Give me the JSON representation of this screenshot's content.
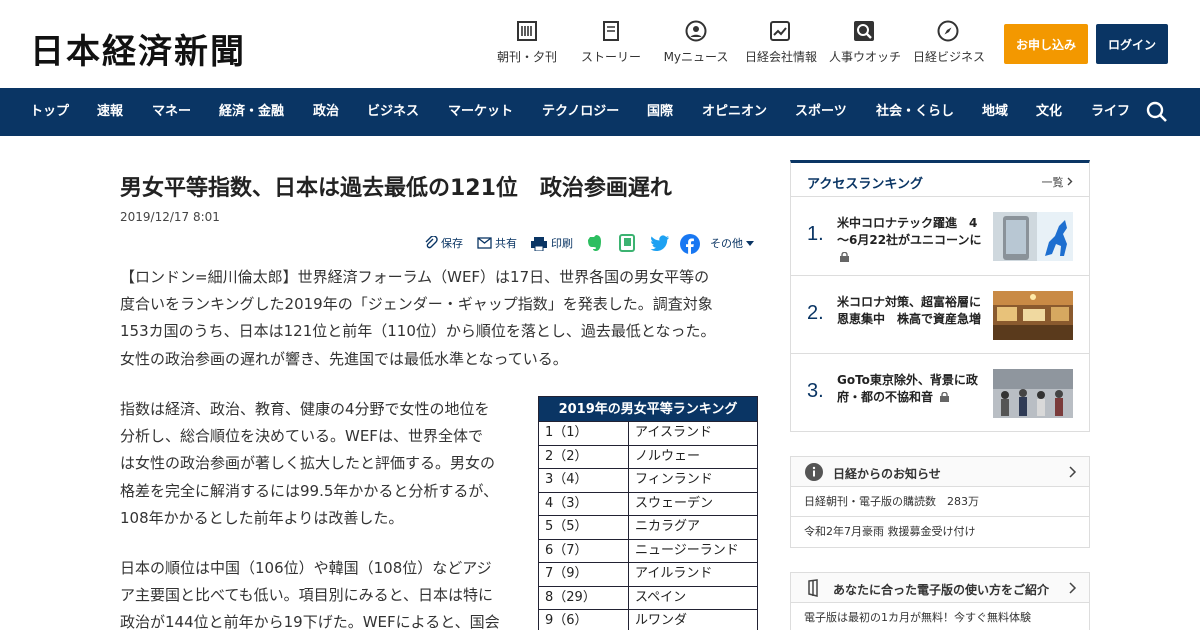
{
  "header": {
    "logo": "日本経済新聞",
    "services": [
      {
        "label": "朝刊・夕刊",
        "icon": "newspaper-icon"
      },
      {
        "label": "ストーリー",
        "icon": "document-icon"
      },
      {
        "label": "Myニュース",
        "icon": "person-icon"
      },
      {
        "label": "日経会社情報",
        "icon": "chart-icon"
      },
      {
        "label": "人事ウオッチ",
        "icon": "search-person-icon"
      },
      {
        "label": "日経ビジネス",
        "icon": "compass-icon"
      }
    ],
    "subscribe_label": "お申し込み",
    "login_label": "ログイン"
  },
  "nav": {
    "items": [
      "トップ",
      "速報",
      "マネー",
      "経済・金融",
      "政治",
      "ビジネス",
      "マーケット",
      "テクノロジー",
      "国際",
      "オピニオン",
      "スポーツ",
      "社会・くらし",
      "地域",
      "文化",
      "ライフ"
    ]
  },
  "article": {
    "title": "男女平等指数、日本は過去最低の121位　政治参画遅れ",
    "date": "2019/12/17 8:01",
    "share": {
      "save": "保存",
      "share": "共有",
      "print": "印刷",
      "other": "その他"
    },
    "p1": [
      "【ロンドン=細川倫太郎】世界経済フォーラム（WEF）は17日、世界各国の男女平等の",
      "度合いをランキングした2019年の「ジェンダー・ギャップ指数」を発表した。調査対象",
      "153カ国のうち、日本は121位と前年（110位）から順位を落とし、過去最低となった。",
      "女性の政治参画の遅れが響き、先進国では最低水準となっている。"
    ],
    "p2": [
      "指数は経済、政治、教育、健康の4分野で女性の地位を",
      "分析し、総合順位を決めている。WEFは、世界全体で",
      "は女性の政治参画が著しく拡大したと評価する。男女の",
      "格差を完全に解消するには99.5年かかると分析するが、",
      "108年かかるとした前年よりは改善した。"
    ],
    "p3": [
      "日本の順位は中国（106位）や韓国（108位）などアジ",
      "ア主要国と比べても低い。項目別にみると、日本は特に",
      "政治が144位と前年から19下げた。WEFによると、国会"
    ]
  },
  "ranking": {
    "title": "2019年の男女平等ランキング",
    "rows": [
      {
        "rank": "1（1）",
        "country": "アイスランド"
      },
      {
        "rank": "2（2）",
        "country": "ノルウェー"
      },
      {
        "rank": "3（4）",
        "country": "フィンランド"
      },
      {
        "rank": "4（3）",
        "country": "スウェーデン"
      },
      {
        "rank": "5（5）",
        "country": "ニカラグア"
      },
      {
        "rank": "6（7）",
        "country": "ニュージーランド"
      },
      {
        "rank": "7（9）",
        "country": "アイルランド"
      },
      {
        "rank": "8（29）",
        "country": "スペイン"
      },
      {
        "rank": "9（6）",
        "country": "ルワンダ"
      }
    ]
  },
  "sidebar": {
    "access_title": "アクセスランキング",
    "access_more": "一覧",
    "access_items": [
      {
        "num": "1.",
        "text": "米中コロナテック躍進　4～6月22社がユニコーンに",
        "locked": true
      },
      {
        "num": "2.",
        "text": "米コロナ対策、超富裕層に恩恵集中　株高で資産急増",
        "locked": false
      },
      {
        "num": "3.",
        "text": "GoTo東京除外、背景に政府・都の不協和音",
        "locked": true
      }
    ],
    "info_title": "日経からのお知らせ",
    "info_lines": [
      "日経朝刊・電子版の購読数　283万",
      "令和2年7月豪雨 救援募金受け付け"
    ],
    "guide_title": "あなたに合った電子版の使い方をご紹介",
    "guide_lines": [
      "電子版は最初の1カ月が無料！今すぐ無料体験"
    ]
  }
}
